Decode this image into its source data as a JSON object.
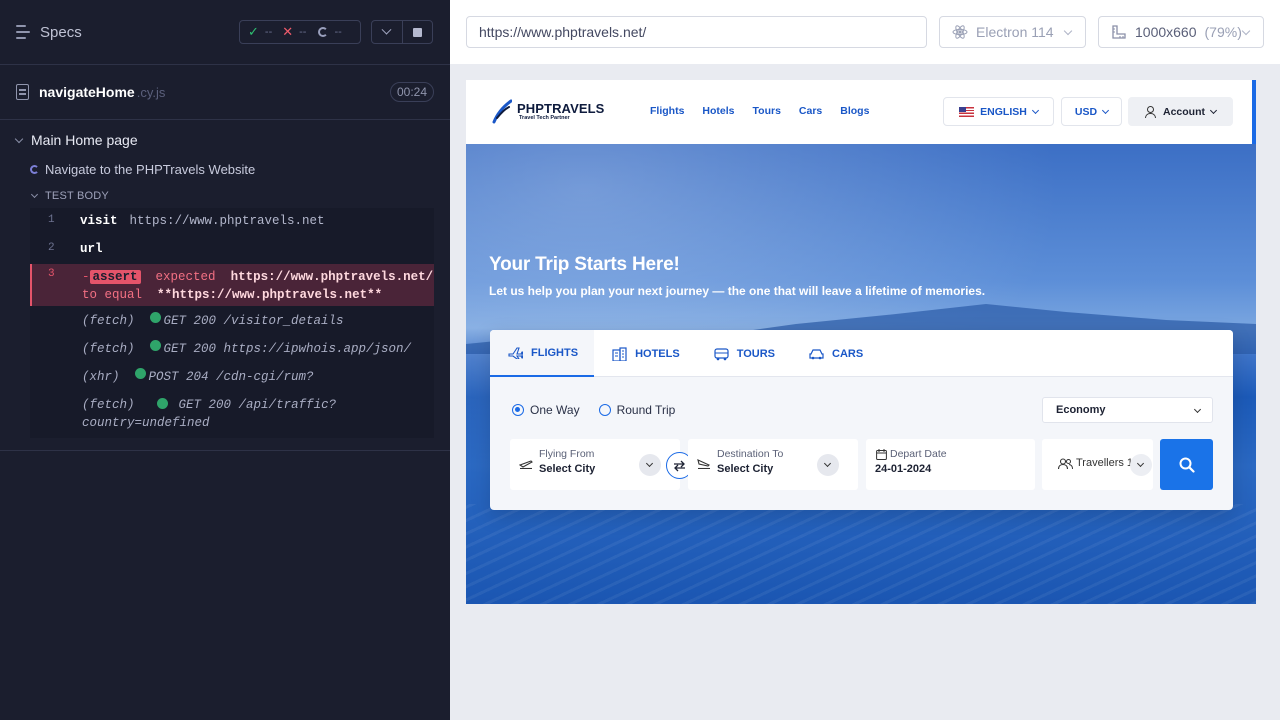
{
  "reporter": {
    "specs_label": "Specs",
    "stats": {
      "passed": "--",
      "failed": "--",
      "pending": "--"
    },
    "spec_file": {
      "name": "navigateHome",
      "ext": ".cy.js",
      "duration": "00:24"
    },
    "suite_title": "Main Home page",
    "test_title": "Navigate to the PHPTravels Website",
    "body_label": "TEST BODY",
    "commands": [
      {
        "num": "1",
        "name": "visit",
        "message": "https://www.phptravels.net"
      },
      {
        "num": "2",
        "name": "url",
        "message": ""
      }
    ],
    "failed_command": {
      "num": "3",
      "dash": "-",
      "tag": "assert",
      "expected_word": "expected",
      "expected_value": "https://www.phptravels.net/",
      "to_equal": "to equal",
      "actual_value": "**https://www.phptravels.net**"
    },
    "network": [
      {
        "kind": "(fetch)",
        "text": "GET 200 /visitor_details"
      },
      {
        "kind": "(fetch)",
        "text": "GET 200 https://ipwhois.app/json/"
      },
      {
        "kind": "(xhr)",
        "text": "POST 204 /cdn-cgi/rum?"
      },
      {
        "kind": "(fetch)",
        "text": "GET 200 /api/traffic?",
        "cont": "country=undefined"
      }
    ]
  },
  "aut": {
    "url": "https://www.phptravels.net/",
    "browser": "Electron 114",
    "viewport": "1000x660",
    "zoom": "(79%)"
  },
  "site": {
    "logo": {
      "name": "PHPTRAVELS",
      "tagline": "Travel Tech Partner"
    },
    "nav_links": [
      "Flights",
      "Hotels",
      "Tours",
      "Cars",
      "Blogs"
    ],
    "language": "ENGLISH",
    "currency": "USD",
    "account": "Account",
    "hero_title": "Your Trip Starts Here!",
    "hero_subtitle": "Let us help you plan your next journey — the one that will leave a lifetime of memories.",
    "tabs": [
      "FLIGHTS",
      "HOTELS",
      "TOURS",
      "CARS"
    ],
    "trip_types": [
      "One Way",
      "Round Trip"
    ],
    "cabin_class": "Economy",
    "flying_from": {
      "label": "Flying From",
      "value": "Select City"
    },
    "destination": {
      "label": "Destination To",
      "value": "Select City"
    },
    "depart": {
      "label": "Depart Date",
      "value": "24-01-2024"
    },
    "travellers": "Travellers 1"
  },
  "colors": {
    "reporter_bg": "#1b1e2e",
    "accent_blue": "#1a6ae6",
    "fail_red": "#e4546a",
    "pass_green": "#2fa46a"
  }
}
